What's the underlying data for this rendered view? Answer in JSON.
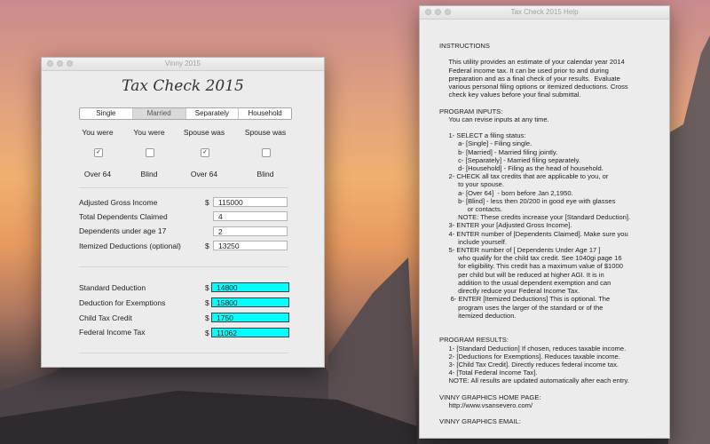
{
  "main_window": {
    "title": "Vinny 2015",
    "app_title": "Tax Check 2015",
    "filing_status": {
      "options": [
        "Single",
        "Married",
        "Separately",
        "Household"
      ],
      "selected": "Married"
    },
    "credit_columns": [
      {
        "head": "You were",
        "checked": true,
        "foot": "Over 64"
      },
      {
        "head": "You were",
        "checked": false,
        "foot": "Blind"
      },
      {
        "head": "Spouse was",
        "checked": true,
        "foot": "Over 64"
      },
      {
        "head": "Spouse was",
        "checked": false,
        "foot": "Blind"
      }
    ],
    "check_mark": "✓",
    "inputs": [
      {
        "label": "Adjusted Gross Income",
        "dollar": "$",
        "value": "115000"
      },
      {
        "label": "Total Dependents Claimed",
        "dollar": "",
        "value": "4"
      },
      {
        "label": "Dependents under age 17",
        "dollar": "",
        "value": "2"
      },
      {
        "label": "Itemized Deductions (optional)",
        "dollar": "$",
        "value": "13250"
      }
    ],
    "results": [
      {
        "label": "Standard Deduction",
        "dollar": "$",
        "value": "14800"
      },
      {
        "label": "Deduction for Exemptions",
        "dollar": "$",
        "value": "15800"
      },
      {
        "label": "Child Tax Credit",
        "dollar": "$",
        "value": "1750"
      },
      {
        "label": "Federal Income Tax",
        "dollar": "$",
        "value": "11062"
      }
    ],
    "result_color": "#00ffff"
  },
  "help_window": {
    "title": "Tax Check 2015 Help",
    "text": "INSTRUCTIONS\n\n     This utility provides an estimate of your calendar year 2014\n     Federal income tax. It can be used prior to and during\n     preparation and as a final check of your results.  Evaluate\n     various personal filing options or itemized deductions. Cross\n     check key values before your final submittal.\n\nPROGRAM INPUTS:\n     You can revise inputs at any time.\n\n     1- SELECT a filing status:\n          a- [Single] - Filing single.\n          b- [Married] - Married filing jointly.\n          c- [Separately] - Married filing separately.\n          d- [Household] - Filing as the head of household.\n     2- CHECK all tax credits that are applicable to you, or\n          to your spouse.\n          a- [Over 64]  - born before Jan 2,1950.\n          b- [Blind] - less then 20/200 in good eye with glasses\n               or contacts.\n          NOTE: These credits increase your [Standard Deduction].\n     3- ENTER your [Adjusted Gross Income].\n     4- ENTER number of [Dependents Claimed]. Make sure you\n          include yourself.\n     5- ENTER number of [ Dependents Under Age 17 ]\n          who qualify for the child tax credit. See 1040gi page 16\n          for eligibility. This credit has a maximum value of $1000\n          per child but will be reduced at higher AGI. It is in\n          addition to the usual dependent exemption and can\n          directly reduce your Federal Income Tax.\n      6- ENTER [Itemized Deductions] This is optional. The\n          program uses the larger of the standard or of the\n          itemized deduction.\n\n\nPROGRAM RESULTS:\n     1- [Standard Deduction] If chosen, reduces taxable income.\n     2- [Deductions for Exemptions]. Reduces taxable income.\n     3- [Child Tax Credit]. Directly reduces federal income tax.\n     4- [Total Federal Income Tax].\n     NOTE: All results are updated automatically after each entry.\n\nVINNY GRAPHICS HOME PAGE:\n     http://www.vsansevero.com/\n\nVINNY GRAPHICS EMAIL:"
  }
}
